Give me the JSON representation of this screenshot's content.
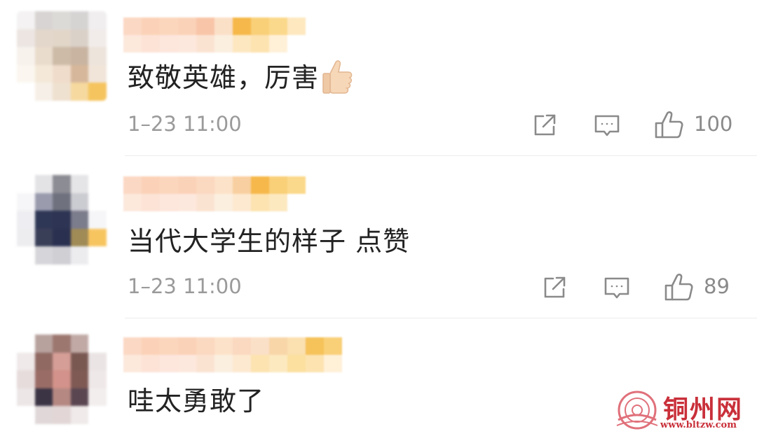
{
  "comments": [
    {
      "text": "致敬英雄，厉害",
      "emoji": "thumbs-up-emoji",
      "time": "1–23 11:00",
      "likes": "100",
      "avatar_colors": [
        "#f4f2f2",
        "#d8d4d3",
        "#dcdad7",
        "#d6d3d3",
        "#f0eeee",
        "#ece5e2",
        "#e3d7cc",
        "#e2d6c9",
        "#dad1c9",
        "#f1ecea",
        "#f7f2ec",
        "#e9dccd",
        "#cdbba8",
        "#c9b4a2",
        "#ede4dc",
        "#fbf6ef",
        "#f4e9d9",
        "#f0dccb",
        "#d6b79c",
        "#f1e5da",
        "#ffffff",
        "#f6efe7",
        "#efe1cf",
        "#f6d99e",
        "#f5c45e"
      ],
      "name_colors": [
        "#fbd8c4",
        "#fbd2b8",
        "#fbd6bd",
        "#fad2b8",
        "#f8c5a8",
        "#fbe0c8",
        "#f6b84a",
        "#f9cf78",
        "#fbd98c",
        "#fde8c0",
        "#fde8dc",
        "#fde3d6",
        "#fde6dc",
        "#fde8de",
        "#fbe3d2",
        "#fbefe0",
        "#fde7c0",
        "#fde3b0",
        "#fff0d8",
        "#ffffff"
      ]
    },
    {
      "text": "当代大学生的样子 点赞",
      "time": "1–23 11:00",
      "likes": "89",
      "avatar_colors": [
        "#ffffff",
        "#e3e3e6",
        "#8c8c94",
        "#e5e5e7",
        "#ffffff",
        "#f6f6f8",
        "#9a9cae",
        "#6f717e",
        "#cbcbd2",
        "#ffffff",
        "#eeeef2",
        "#2f3756",
        "#2e3453",
        "#7b7c8c",
        "#f6f6f8",
        "#ededf0",
        "#3a3f58",
        "#2a3050",
        "#a08a55",
        "#f7c560",
        "#ffffff",
        "#d6d6da",
        "#cfcfd4",
        "#ececef",
        "#ffffff"
      ],
      "name_colors": [
        "#fbd8c4",
        "#fbd2b8",
        "#fbd6bd",
        "#fad2b8",
        "#fbd8c0",
        "#fce2c8",
        "#f8cfa0",
        "#f6b84a",
        "#f9cf78",
        "#fbd98c",
        "#fde8dc",
        "#fde3d6",
        "#fde6dc",
        "#fde8de",
        "#fbe3d2",
        "#fbefe0",
        "#fde9d0",
        "#fde3b0",
        "#fde9c0",
        "#ffffff"
      ]
    },
    {
      "text": "哇太勇敢了",
      "avatar_colors": [
        "#ffffff",
        "#b8a29e",
        "#9c7770",
        "#c1aaa6",
        "#ffffff",
        "#efe9e9",
        "#8f6962",
        "#d59e97",
        "#7a5852",
        "#ebe4e4",
        "#e6dcdc",
        "#9a6c66",
        "#d3928b",
        "#7f5a55",
        "#efe8e8",
        "#ece6e6",
        "#3a3445",
        "#b58882",
        "#5a4651",
        "#f3eeee",
        "#ffffff",
        "#e0d8d8",
        "#e2d6d6",
        "#f0eaea",
        "#ffffff"
      ],
      "name_colors": [
        "#fbd8c4",
        "#fbd2b8",
        "#fbd6bd",
        "#fad2b8",
        "#fbd8c0",
        "#fce2c8",
        "#fbd8c0",
        "#fbe0c8",
        "#f8d6a8",
        "#fbe0b0",
        "#f6c25a",
        "#f9cf78",
        "#fde8dc",
        "#fde3d6",
        "#fde6dc",
        "#fde8de",
        "#fbe3d2",
        "#fbefe0",
        "#fde9d0",
        "#fde3b0",
        "#fde9c0",
        "#fbe0a0",
        "#fde3b0",
        "#fff0d8"
      ]
    }
  ],
  "watermark": {
    "title": "铜州网",
    "url": "www.bltzw.com",
    "color": "#c9303a"
  },
  "icons": {
    "share": "share-icon",
    "reply": "reply-comment-icon",
    "like": "thumbs-up-outline-icon"
  }
}
